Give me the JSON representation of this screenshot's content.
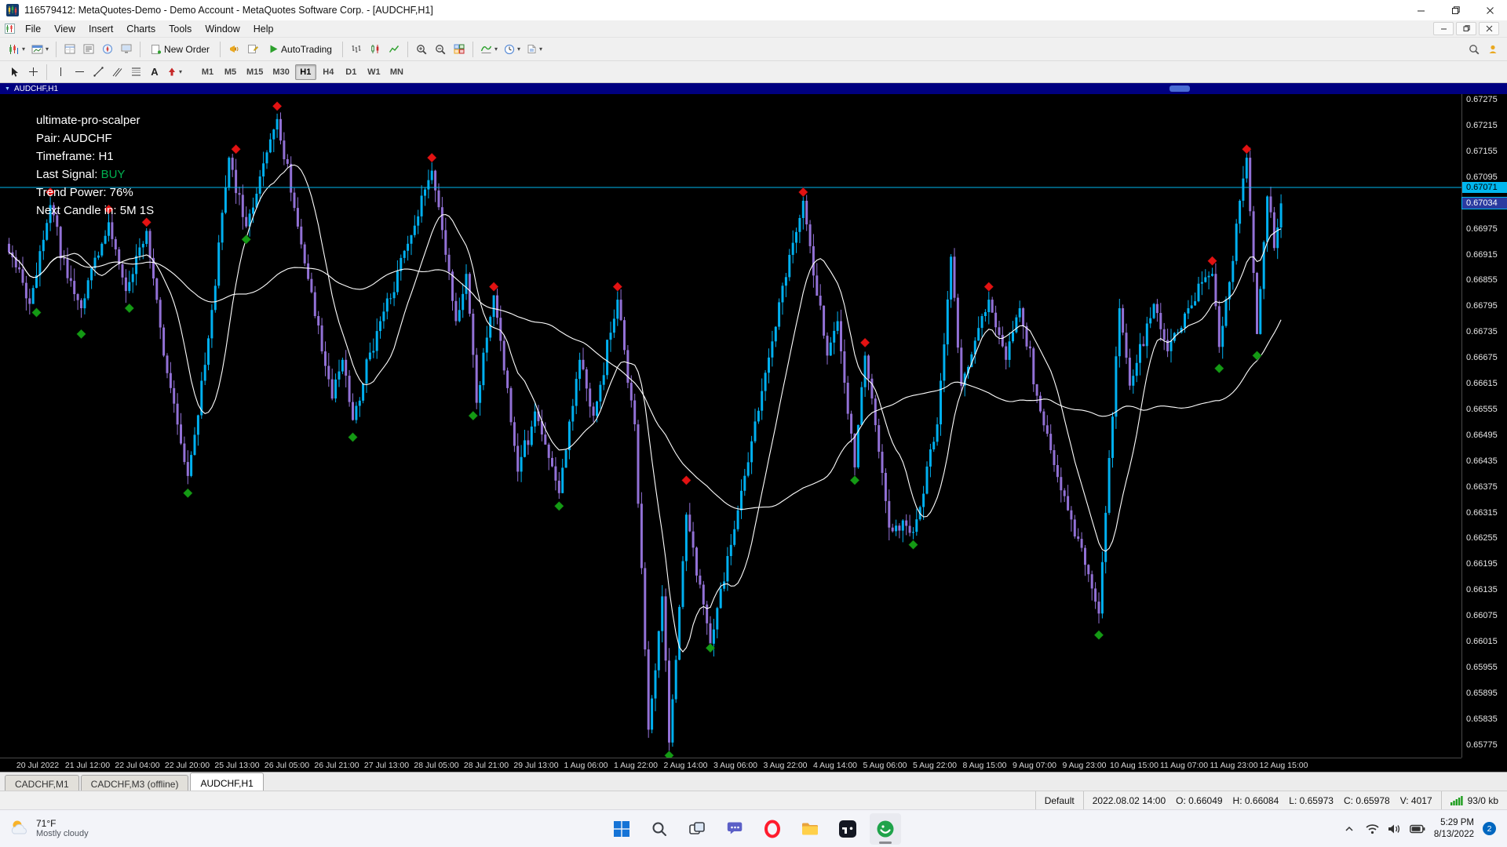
{
  "window": {
    "title": "116579412: MetaQuotes-Demo - Demo Account - MetaQuotes Software Corp. - [AUDCHF,H1]"
  },
  "icons": {
    "dropdown": "▾",
    "collapse": "▼"
  },
  "menu": {
    "items": [
      "File",
      "View",
      "Insert",
      "Charts",
      "Tools",
      "Window",
      "Help"
    ]
  },
  "toolbar": {
    "new_order": "New Order",
    "autotrading": "AutoTrading",
    "text_tool": "A"
  },
  "timeframes": {
    "items": [
      "M1",
      "M5",
      "M15",
      "M30",
      "H1",
      "H4",
      "D1",
      "W1",
      "MN"
    ],
    "active": "H1"
  },
  "chart": {
    "caption": "AUDCHF,H1",
    "indicator_panel": {
      "title": "ultimate-pro-scalper",
      "pair": "Pair: AUDCHF",
      "timeframe": "Timeframe: H1",
      "last_signal_label": "Last Signal: ",
      "last_signal_value": "BUY",
      "trend_power": "Trend Power: 76%",
      "next_candle": "Next Candle in: 5M 1S"
    }
  },
  "chart_data": {
    "type": "candlestick",
    "symbol": "AUDCHF",
    "timeframe": "H1",
    "candles_total": 371,
    "candle_region_width": 1625,
    "plot_price_max": 0.67288,
    "plot_price_min": 0.65745,
    "price_line": {
      "ask": 0.67071,
      "ask_label": "0.67071",
      "bid": 0.67034,
      "bid_label": "0.67034"
    },
    "colors": {
      "bull": "#00b0f0",
      "bear": "#9271d6",
      "ma": "#ffffff",
      "sell": "#e31212",
      "buy": "#149a14",
      "ask_line": "#00b7ef",
      "background": "#000000"
    },
    "y_labels": [
      "0.67275",
      "0.67215",
      "0.67155",
      "0.67095",
      "0.67035",
      "0.66975",
      "0.66915",
      "0.66855",
      "0.66795",
      "0.66735",
      "0.66675",
      "0.66615",
      "0.66555",
      "0.66495",
      "0.66435",
      "0.66375",
      "0.66315",
      "0.66255",
      "0.66195",
      "0.66135",
      "0.66075",
      "0.66015",
      "0.65955",
      "0.65895",
      "0.65835",
      "0.65775"
    ],
    "x_labels": [
      "20 Jul 2022",
      "21 Jul 12:00",
      "22 Jul 04:00",
      "22 Jul 20:00",
      "25 Jul 13:00",
      "26 Jul 05:00",
      "26 Jul 21:00",
      "27 Jul 13:00",
      "28 Jul 05:00",
      "28 Jul 21:00",
      "29 Jul 13:00",
      "1 Aug 06:00",
      "1 Aug 22:00",
      "2 Aug 14:00",
      "3 Aug 06:00",
      "3 Aug 22:00",
      "4 Aug 14:00",
      "5 Aug 06:00",
      "5 Aug 22:00",
      "8 Aug 15:00",
      "9 Aug 07:00",
      "9 Aug 23:00",
      "10 Aug 15:00",
      "11 Aug 07:00",
      "11 Aug 23:00",
      "12 Aug 15:00"
    ],
    "anchors": [
      [
        0,
        0.6692
      ],
      [
        6,
        0.668
      ],
      [
        12,
        0.6703
      ],
      [
        17,
        0.6686
      ],
      [
        21,
        0.6679
      ],
      [
        27,
        0.6694
      ],
      [
        29,
        0.6699
      ],
      [
        34,
        0.6683
      ],
      [
        40,
        0.6697
      ],
      [
        45,
        0.6668
      ],
      [
        52,
        0.664
      ],
      [
        58,
        0.6672
      ],
      [
        64,
        0.6714
      ],
      [
        69,
        0.6698
      ],
      [
        78,
        0.6723
      ],
      [
        84,
        0.6698
      ],
      [
        94,
        0.6658
      ],
      [
        97,
        0.6667
      ],
      [
        100,
        0.6653
      ],
      [
        108,
        0.6676
      ],
      [
        116,
        0.6694
      ],
      [
        123,
        0.6711
      ],
      [
        130,
        0.6676
      ],
      [
        133,
        0.6687
      ],
      [
        136,
        0.6657
      ],
      [
        141,
        0.6682
      ],
      [
        148,
        0.6641
      ],
      [
        153,
        0.6655
      ],
      [
        160,
        0.6636
      ],
      [
        166,
        0.6667
      ],
      [
        170,
        0.6654
      ],
      [
        177,
        0.6681
      ],
      [
        182,
        0.6652
      ],
      [
        186,
        0.6581
      ],
      [
        190,
        0.6612
      ],
      [
        192,
        0.6578
      ],
      [
        197,
        0.6631
      ],
      [
        204,
        0.6601
      ],
      [
        212,
        0.6632
      ],
      [
        220,
        0.6664
      ],
      [
        231,
        0.6704
      ],
      [
        238,
        0.6668
      ],
      [
        241,
        0.6676
      ],
      [
        246,
        0.6642
      ],
      [
        249,
        0.6668
      ],
      [
        256,
        0.6628
      ],
      [
        263,
        0.6627
      ],
      [
        270,
        0.6652
      ],
      [
        274,
        0.6691
      ],
      [
        277,
        0.6661
      ],
      [
        285,
        0.6681
      ],
      [
        290,
        0.6667
      ],
      [
        294,
        0.6679
      ],
      [
        300,
        0.6655
      ],
      [
        308,
        0.6632
      ],
      [
        317,
        0.6608
      ],
      [
        323,
        0.6679
      ],
      [
        326,
        0.6661
      ],
      [
        333,
        0.668
      ],
      [
        337,
        0.6669
      ],
      [
        343,
        0.6679
      ],
      [
        350,
        0.6687
      ],
      [
        352,
        0.667
      ],
      [
        360,
        0.6714
      ],
      [
        363,
        0.6673
      ],
      [
        366,
        0.6705
      ],
      [
        368,
        0.6693
      ],
      [
        370,
        0.67034
      ]
    ],
    "signals": {
      "sell": [
        [
          12,
          0.6706
        ],
        [
          29,
          0.6702
        ],
        [
          40,
          0.6699
        ],
        [
          66,
          0.6716
        ],
        [
          78,
          0.6726
        ],
        [
          123,
          0.6714
        ],
        [
          141,
          0.6684
        ],
        [
          177,
          0.6684
        ],
        [
          197,
          0.6639
        ],
        [
          231,
          0.6706
        ],
        [
          249,
          0.6671
        ],
        [
          285,
          0.6684
        ],
        [
          350,
          0.669
        ],
        [
          360,
          0.6716
        ]
      ],
      "buy": [
        [
          8,
          0.6678
        ],
        [
          21,
          0.6673
        ],
        [
          35,
          0.6679
        ],
        [
          52,
          0.6636
        ],
        [
          69,
          0.6695
        ],
        [
          100,
          0.6649
        ],
        [
          135,
          0.6654
        ],
        [
          160,
          0.6633
        ],
        [
          192,
          0.6575
        ],
        [
          204,
          0.66
        ],
        [
          246,
          0.6639
        ],
        [
          263,
          0.6624
        ],
        [
          317,
          0.6603
        ],
        [
          352,
          0.6665
        ],
        [
          363,
          0.6668
        ]
      ]
    }
  },
  "tabs": {
    "items": [
      "CADCHF,M1",
      "CADCHF,M3 (offline)",
      "AUDCHF,H1"
    ]
  },
  "status": {
    "profile": "Default",
    "bar": {
      "datetime": "2022.08.02 14:00",
      "open": "O: 0.66049",
      "high": "H: 0.66084",
      "low": "L: 0.65973",
      "close": "C: 0.65978",
      "volume": "V: 4017"
    },
    "connection": "93/0 kb"
  },
  "taskbar": {
    "weather": {
      "temp": "71°F",
      "condition": "Mostly cloudy"
    },
    "clock": {
      "time": "5:29 PM",
      "date": "8/13/2022"
    },
    "notifications": "2"
  }
}
